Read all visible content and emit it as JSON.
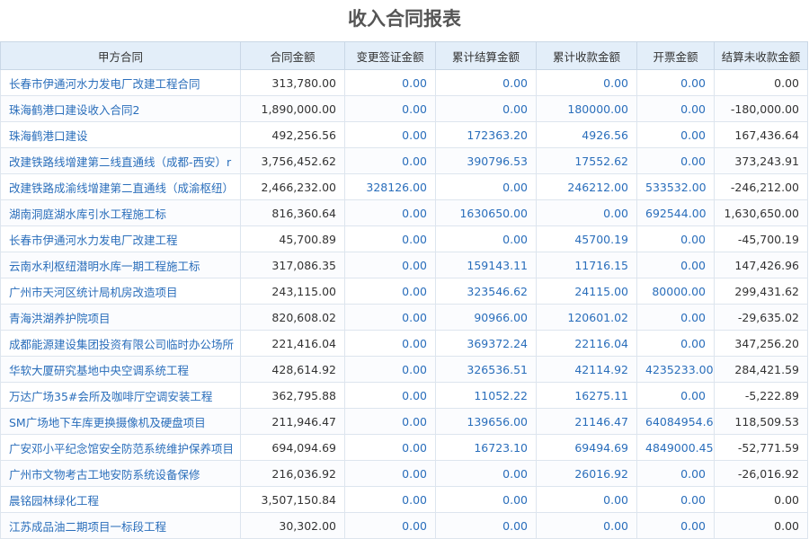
{
  "title": "收入合同报表",
  "columns": [
    "甲方合同",
    "合同金额",
    "变更签证金额",
    "累计结算金额",
    "累计收款金额",
    "开票金额",
    "结算未收款金额"
  ],
  "rows": [
    [
      "长春市伊通河水力发电厂改建工程合同",
      "313,780.00",
      "0.00",
      "0.00",
      "0.00",
      "0.00",
      "0.00"
    ],
    [
      "珠海鹤港口建设收入合同2",
      "1,890,000.00",
      "0.00",
      "0.00",
      "180000.00",
      "0.00",
      "-180,000.00"
    ],
    [
      "珠海鹤港口建设",
      "492,256.56",
      "0.00",
      "172363.20",
      "4926.56",
      "0.00",
      "167,436.64"
    ],
    [
      "改建铁路线增建第二线直通线（成都-西安）r",
      "3,756,452.62",
      "0.00",
      "390796.53",
      "17552.62",
      "0.00",
      "373,243.91"
    ],
    [
      "改建铁路成渝线增建第二直通线（成渝枢纽）",
      "2,466,232.00",
      "328126.00",
      "0.00",
      "246212.00",
      "533532.00",
      "-246,212.00"
    ],
    [
      "湖南洞庭湖水库引水工程施工标",
      "816,360.64",
      "0.00",
      "1630650.00",
      "0.00",
      "692544.00",
      "1,630,650.00"
    ],
    [
      "长春市伊通河水力发电厂改建工程",
      "45,700.89",
      "0.00",
      "0.00",
      "45700.19",
      "0.00",
      "-45,700.19"
    ],
    [
      "云南水利枢纽潜明水库一期工程施工标",
      "317,086.35",
      "0.00",
      "159143.11",
      "11716.15",
      "0.00",
      "147,426.96"
    ],
    [
      "广州市天河区统计局机房改造项目",
      "243,115.00",
      "0.00",
      "323546.62",
      "24115.00",
      "80000.00",
      "299,431.62"
    ],
    [
      "青海洪湖养护院项目",
      "820,608.02",
      "0.00",
      "90966.00",
      "120601.02",
      "0.00",
      "-29,635.02"
    ],
    [
      "成都能源建设集团投资有限公司临时办公场所",
      "221,416.04",
      "0.00",
      "369372.24",
      "22116.04",
      "0.00",
      "347,256.20"
    ],
    [
      "华软大厦研究基地中央空调系统工程",
      "428,614.92",
      "0.00",
      "326536.51",
      "42114.92",
      "4235233.00",
      "284,421.59"
    ],
    [
      "万达广场35#会所及咖啡厅空调安装工程",
      "362,795.88",
      "0.00",
      "11052.22",
      "16275.11",
      "0.00",
      "-5,222.89"
    ],
    [
      "SM广场地下车库更换摄像机及硬盘项目",
      "211,946.47",
      "0.00",
      "139656.00",
      "21146.47",
      "64084954.65",
      "118,509.53"
    ],
    [
      "广安邓小平纪念馆安全防范系统维护保养项目",
      "694,094.69",
      "0.00",
      "16723.10",
      "69494.69",
      "4849000.45",
      "-52,771.59"
    ],
    [
      "广州市文物考古工地安防系统设备保修",
      "216,036.92",
      "0.00",
      "0.00",
      "26016.92",
      "0.00",
      "-26,016.92"
    ],
    [
      "晨铭园林绿化工程",
      "3,507,150.84",
      "0.00",
      "0.00",
      "0.00",
      "0.00",
      "0.00"
    ],
    [
      "江苏成品油二期项目一标段工程",
      "30,302.00",
      "0.00",
      "0.00",
      "0.00",
      "0.00",
      "0.00"
    ]
  ],
  "colors": {
    "link": "#2a6ebb",
    "header_bg": "#e3eef9",
    "border": "#dde5ee"
  }
}
